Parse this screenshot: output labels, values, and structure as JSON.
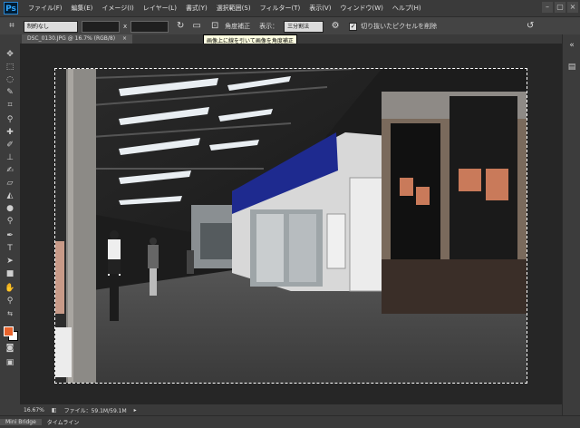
{
  "app": {
    "logo": "Ps"
  },
  "menu": [
    "ファイル(F)",
    "編集(E)",
    "イメージ(I)",
    "レイヤー(L)",
    "書式(Y)",
    "選択範囲(S)",
    "フィルター(T)",
    "表示(V)",
    "ウィンドウ(W)",
    "ヘルプ(H)"
  ],
  "options": {
    "ratio_select": "制約なし",
    "swap_symbol": "x",
    "straighten_label": "角度補正",
    "view_label": "表示：",
    "view_select": "三分割法",
    "delete_cropped_label": "切り抜いたピクセルを削除"
  },
  "tooltip": "画像上に線を引いて画像を角度補正",
  "document": {
    "tab_title": "DSC_0130.JPG @ 16.7% (RGB/8)",
    "close_symbol": "×"
  },
  "status": {
    "zoom": "16.67%",
    "file_info": "ファイル：59.1M/59.1M"
  },
  "panels": [
    "Mini Bridge",
    "タイムライン"
  ],
  "colors": {
    "foreground": "#e8632c",
    "background": "#ffffff"
  }
}
